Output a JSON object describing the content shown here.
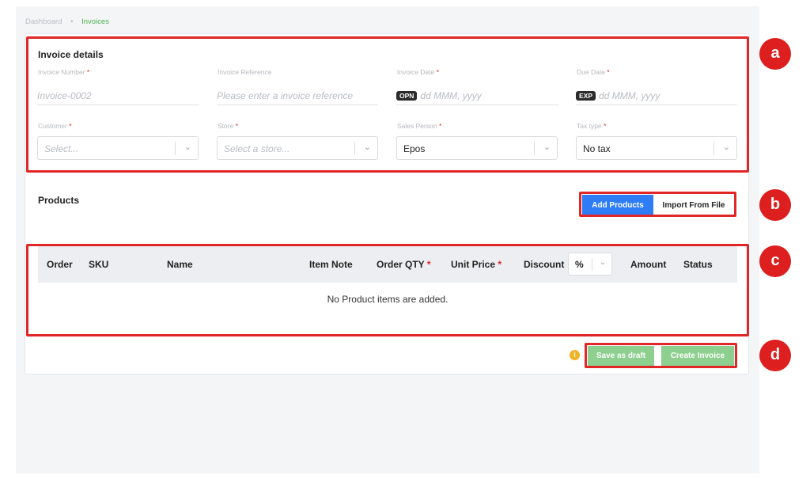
{
  "breadcrumb": {
    "root": "Dashboard",
    "separator": "•",
    "current": "Invoices"
  },
  "invoice_details": {
    "title": "Invoice details",
    "required_mark": "*",
    "invoice_number": {
      "label": "Invoice Number",
      "placeholder": "Invoice-0002"
    },
    "invoice_reference": {
      "label": "Invoice Reference",
      "placeholder": "Please enter a invoice reference"
    },
    "invoice_date": {
      "label": "Invoice Date",
      "tag": "OPN",
      "placeholder": "dd MMM, yyyy"
    },
    "due_date": {
      "label": "Due Date",
      "tag": "EXP",
      "placeholder": "dd MMM, yyyy"
    },
    "customer": {
      "label": "Customer",
      "placeholder": "Select..."
    },
    "store": {
      "label": "Store",
      "placeholder": "Select a store..."
    },
    "sales_person": {
      "label": "Sales Person",
      "value": "Epos"
    },
    "tax_type": {
      "label": "Tax type",
      "value": "No tax"
    }
  },
  "products": {
    "title": "Products",
    "add_button": "Add Products",
    "import_button": "Import From File"
  },
  "table": {
    "columns": {
      "order": "Order",
      "sku": "SKU",
      "name": "Name",
      "item_note": "Item Note",
      "order_qty": "Order QTY",
      "unit_price": "Unit Price",
      "discount": "Discount",
      "amount": "Amount",
      "status": "Status"
    },
    "discount_type": "%",
    "empty_message": "No Product items are added."
  },
  "footer": {
    "info_glyph": "i",
    "save_draft": "Save as draft",
    "create_invoice": "Create Invoice"
  },
  "markers": {
    "a": "a",
    "b": "b",
    "c": "c",
    "d": "d"
  },
  "colors": {
    "accent_blue": "#2e7cf6",
    "action_green": "#8ccf8e",
    "highlight_red": "#e02626",
    "breadcrumb_active": "#4caf50",
    "info_yellow": "#f0b323"
  },
  "icons": {
    "chevron": "chevron-down-icon",
    "info": "info-icon"
  }
}
